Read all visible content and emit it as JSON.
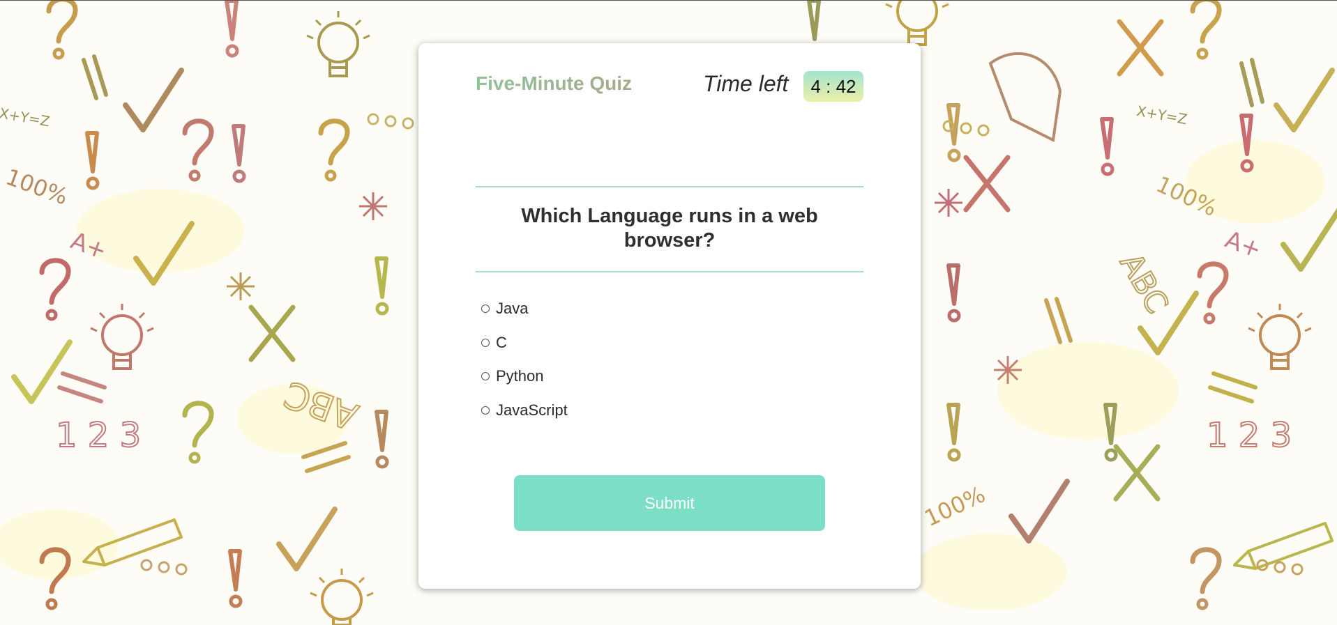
{
  "quiz": {
    "title": "Five-Minute Quiz",
    "timer_label": "Time left",
    "timer_value": "4 : 42"
  },
  "question": {
    "text": "Which Language runs in a web browser?",
    "options": [
      {
        "label": "Java"
      },
      {
        "label": "C"
      },
      {
        "label": "Python"
      },
      {
        "label": "JavaScript"
      }
    ]
  },
  "actions": {
    "submit_label": "Submit"
  },
  "colors": {
    "title_gradient_start": "#8fc29a",
    "title_gradient_end": "#a8a98a",
    "timer_gradient_top": "#a3e4d0",
    "timer_gradient_bottom": "#ecefa8",
    "divider": "#a8dccb",
    "submit_bg": "#7ddec6"
  }
}
